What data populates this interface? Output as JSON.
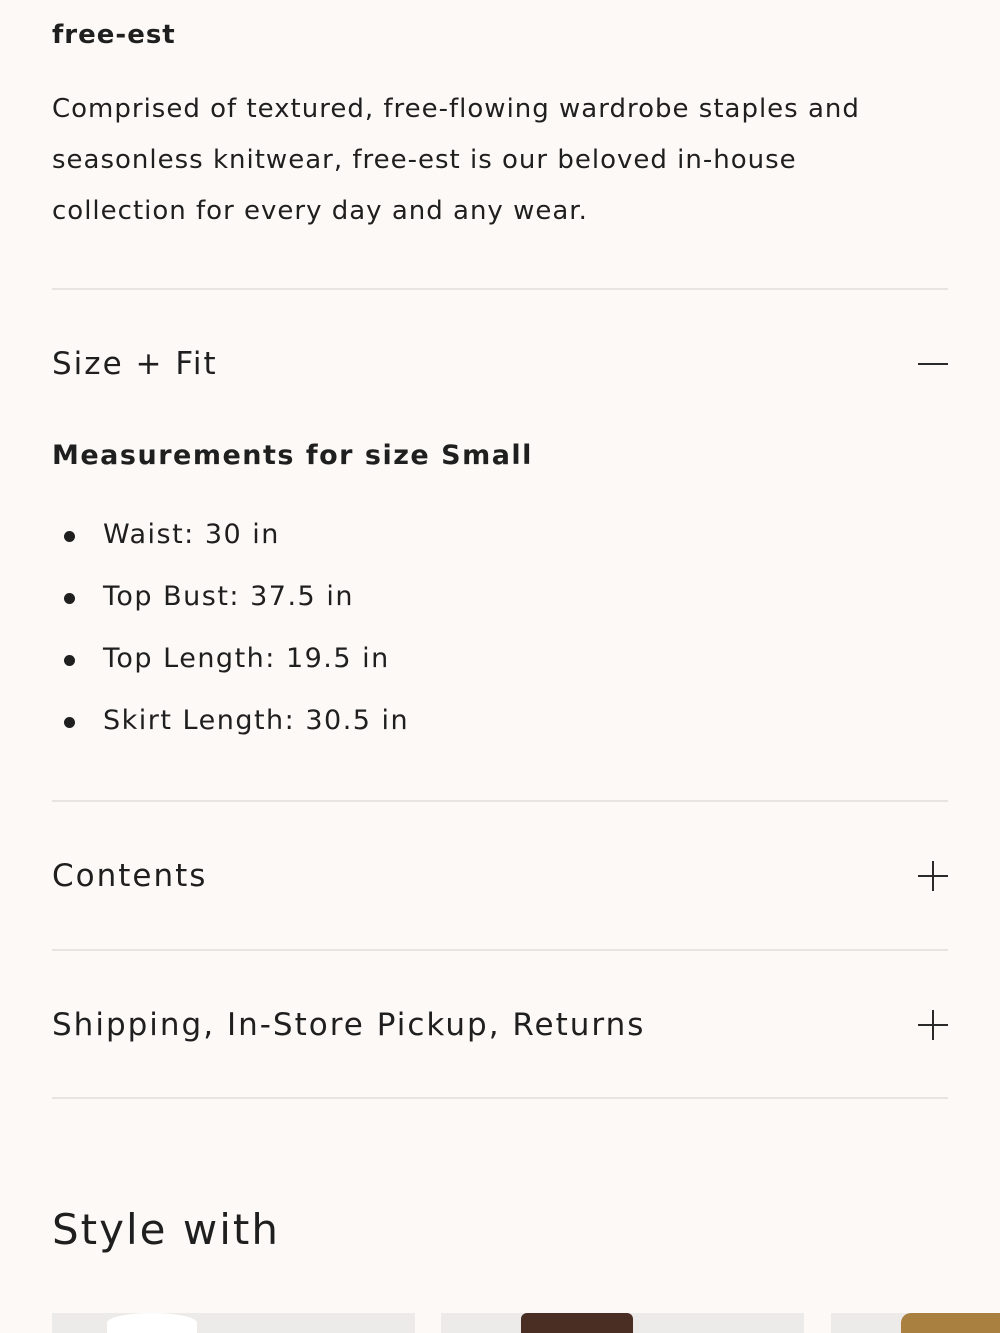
{
  "brand": {
    "title": "free-est",
    "description": "Comprised of textured, free-flowing wardrobe staples and seasonless knitwear, free-est is our beloved in-house collection for every day and any wear."
  },
  "accordion": {
    "size_fit": {
      "title": "Size + Fit",
      "expanded": true,
      "measurements_title": "Measurements for size Small",
      "measurements": [
        "Waist: 30 in",
        "Top Bust: 37.5 in",
        "Top Length: 19.5 in",
        "Skirt Length: 30.5 in"
      ]
    },
    "contents": {
      "title": "Contents",
      "expanded": false
    },
    "shipping": {
      "title": "Shipping, In-Store Pickup, Returns",
      "expanded": false
    }
  },
  "style_with": {
    "title": "Style with"
  },
  "icons": {
    "collapse": "minus-icon",
    "expand": "plus-icon"
  },
  "colors": {
    "background": "#fdf9f7",
    "text": "#1f1f1f",
    "divider": "#e8e4e1"
  }
}
